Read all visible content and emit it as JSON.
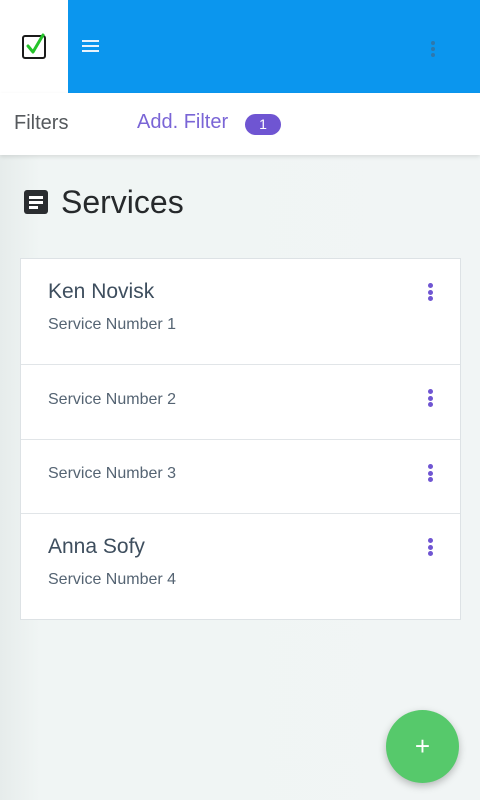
{
  "header": {
    "logo_icon": "checkbox-check-icon",
    "menu_icon": "hamburger-icon",
    "more_icon": "kebab-vertical-icon",
    "colors": {
      "bar": "#0b96ee",
      "check": "#25c32a"
    }
  },
  "filterbar": {
    "filters_label": "Filters",
    "add_filter_label": "Add. Filter",
    "filter_count": "1",
    "colors": {
      "accent": "#7a65d6",
      "badge": "#6f55d2"
    }
  },
  "page": {
    "title": "Services",
    "title_icon": "document-icon"
  },
  "services": [
    {
      "name": "Ken Novisk",
      "service": "Service Number 1"
    },
    {
      "name": "",
      "service": "Service Number 2"
    },
    {
      "name": "",
      "service": "Service Number 3"
    },
    {
      "name": "Anna Sofy",
      "service": "Service Number 4"
    }
  ],
  "fab": {
    "label": "+",
    "color": "#56c96b"
  }
}
